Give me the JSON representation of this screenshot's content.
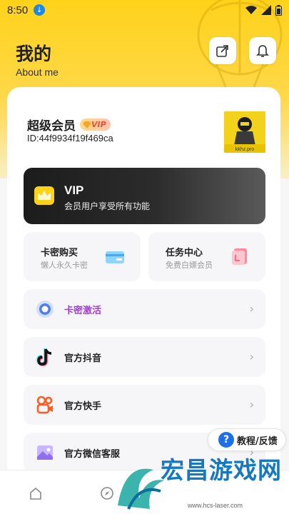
{
  "status": {
    "time": "8:50"
  },
  "header": {
    "title": "我的",
    "subtitle": "About me"
  },
  "user": {
    "name": "超级会员",
    "vip_badge": "VIP",
    "id_text": "ID:44f9934f19f469ca",
    "avatar_caption": "kkhz.pro"
  },
  "vip_banner": {
    "title": "VIP",
    "subtitle": "会员用户享受所有功能"
  },
  "cards": [
    {
      "title": "卡密购买",
      "subtitle": "懒人永久卡密"
    },
    {
      "title": "任务中心",
      "subtitle": "免费白嫖会员"
    }
  ],
  "menu": [
    {
      "label": "卡密激活",
      "color": "#a33dd6"
    },
    {
      "label": "官方抖音"
    },
    {
      "label": "官方快手"
    },
    {
      "label": "官方微信客服"
    }
  ],
  "help_button": {
    "label": "教程/反馈"
  },
  "watermark": {
    "title": "宏昌游戏网",
    "url": "www.hcs-laser.com"
  },
  "colors": {
    "accent_yellow": "#ffd21a",
    "help_blue": "#1e6fe8"
  }
}
